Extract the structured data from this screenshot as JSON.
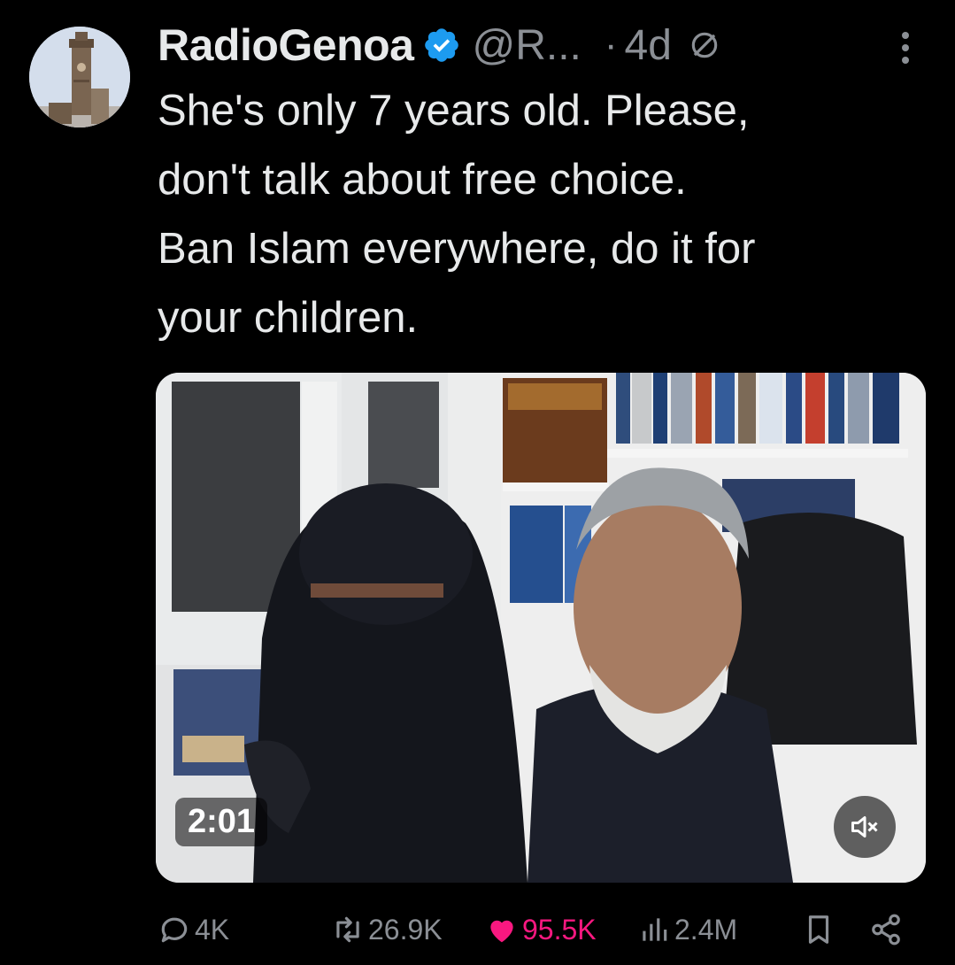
{
  "author": {
    "display_name": "RadioGenoa",
    "handle": "@R...",
    "separator": "·",
    "time": "4d",
    "verified": true,
    "verified_color": "#1d9bf0"
  },
  "tweet": {
    "lines": [
      "She's only 7 years old. Please,",
      "don't talk about free choice.",
      "Ban Islam everywhere, do it for",
      "your children."
    ]
  },
  "media": {
    "type": "video",
    "duration": "2:01",
    "muted": true
  },
  "actions": {
    "replies": "4K",
    "reposts": "26.9K",
    "likes": "95.5K",
    "views": "2.4M",
    "like_color": "#f91880"
  },
  "icons": {
    "reply": "speech-bubble-icon",
    "repost": "repost-arrows-icon",
    "like": "heart-icon",
    "views": "bar-chart-icon",
    "bookmark": "bookmark-icon",
    "share": "share-icon",
    "more": "vertical-ellipsis-icon",
    "mute": "speaker-muted-icon",
    "verified": "verified-badge-icon",
    "no_reply": "circle-slash-icon"
  }
}
